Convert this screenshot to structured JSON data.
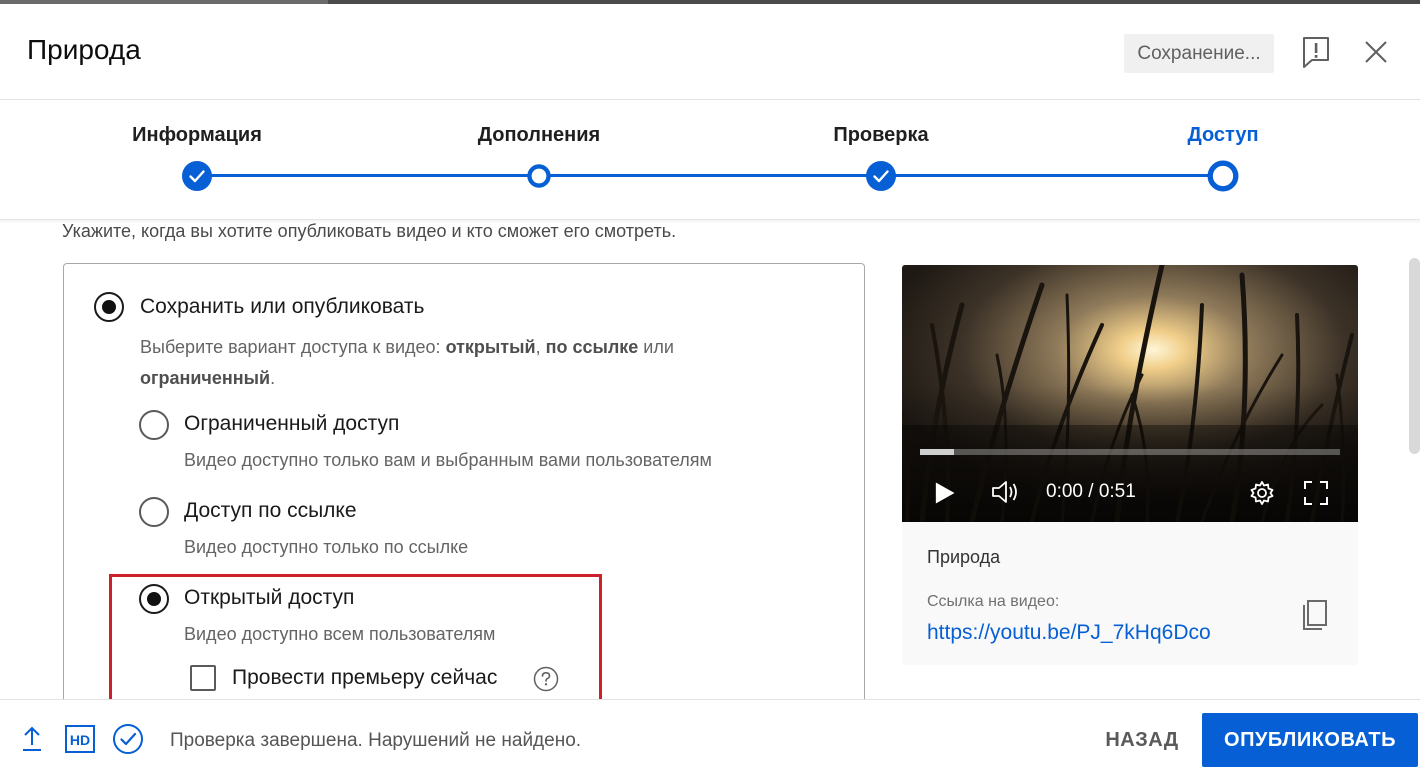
{
  "header": {
    "title": "Природа",
    "saving_label": "Сохранение..."
  },
  "stepper": {
    "steps": [
      {
        "label": "Информация",
        "state": "completed"
      },
      {
        "label": "Дополнения",
        "state": "visited"
      },
      {
        "label": "Проверка",
        "state": "completed"
      },
      {
        "label": "Доступ",
        "state": "current"
      }
    ]
  },
  "visibility": {
    "instruction": "Укажите, когда вы хотите опубликовать видео и кто сможет его смотреть.",
    "save_or_publish": {
      "title": "Сохранить или опубликовать",
      "desc_prefix": "Выберите вариант доступа к видео: ",
      "opt_public": "открытый",
      "sep": ", ",
      "opt_unlisted": "по ссылке",
      "or_word": " или",
      "opt_private": "ограниченный",
      "period": ".",
      "selected": true
    },
    "options": [
      {
        "title": "Ограниченный доступ",
        "desc": "Видео доступно только вам и выбранным вами пользователям",
        "selected": false
      },
      {
        "title": "Доступ по ссылке",
        "desc": "Видео доступно только по ссылке",
        "selected": false
      },
      {
        "title": "Открытый доступ",
        "desc": "Видео доступно всем пользователям",
        "selected": true
      }
    ],
    "premiere": {
      "label": "Провести премьеру сейчас",
      "checked": false
    }
  },
  "preview": {
    "timecode": "0:00 / 0:51",
    "progress": 0.08,
    "video_title": "Природа",
    "link_label": "Ссылка на видео:",
    "link_url": "https://youtu.be/PJ_7kHq6Dco"
  },
  "footer": {
    "status": "Проверка завершена. Нарушений не найдено.",
    "back_label": "НАЗАД",
    "publish_label": "ОПУБЛИКОВАТЬ"
  },
  "colors": {
    "accent": "#065fd4",
    "highlight": "#d01f2c"
  }
}
